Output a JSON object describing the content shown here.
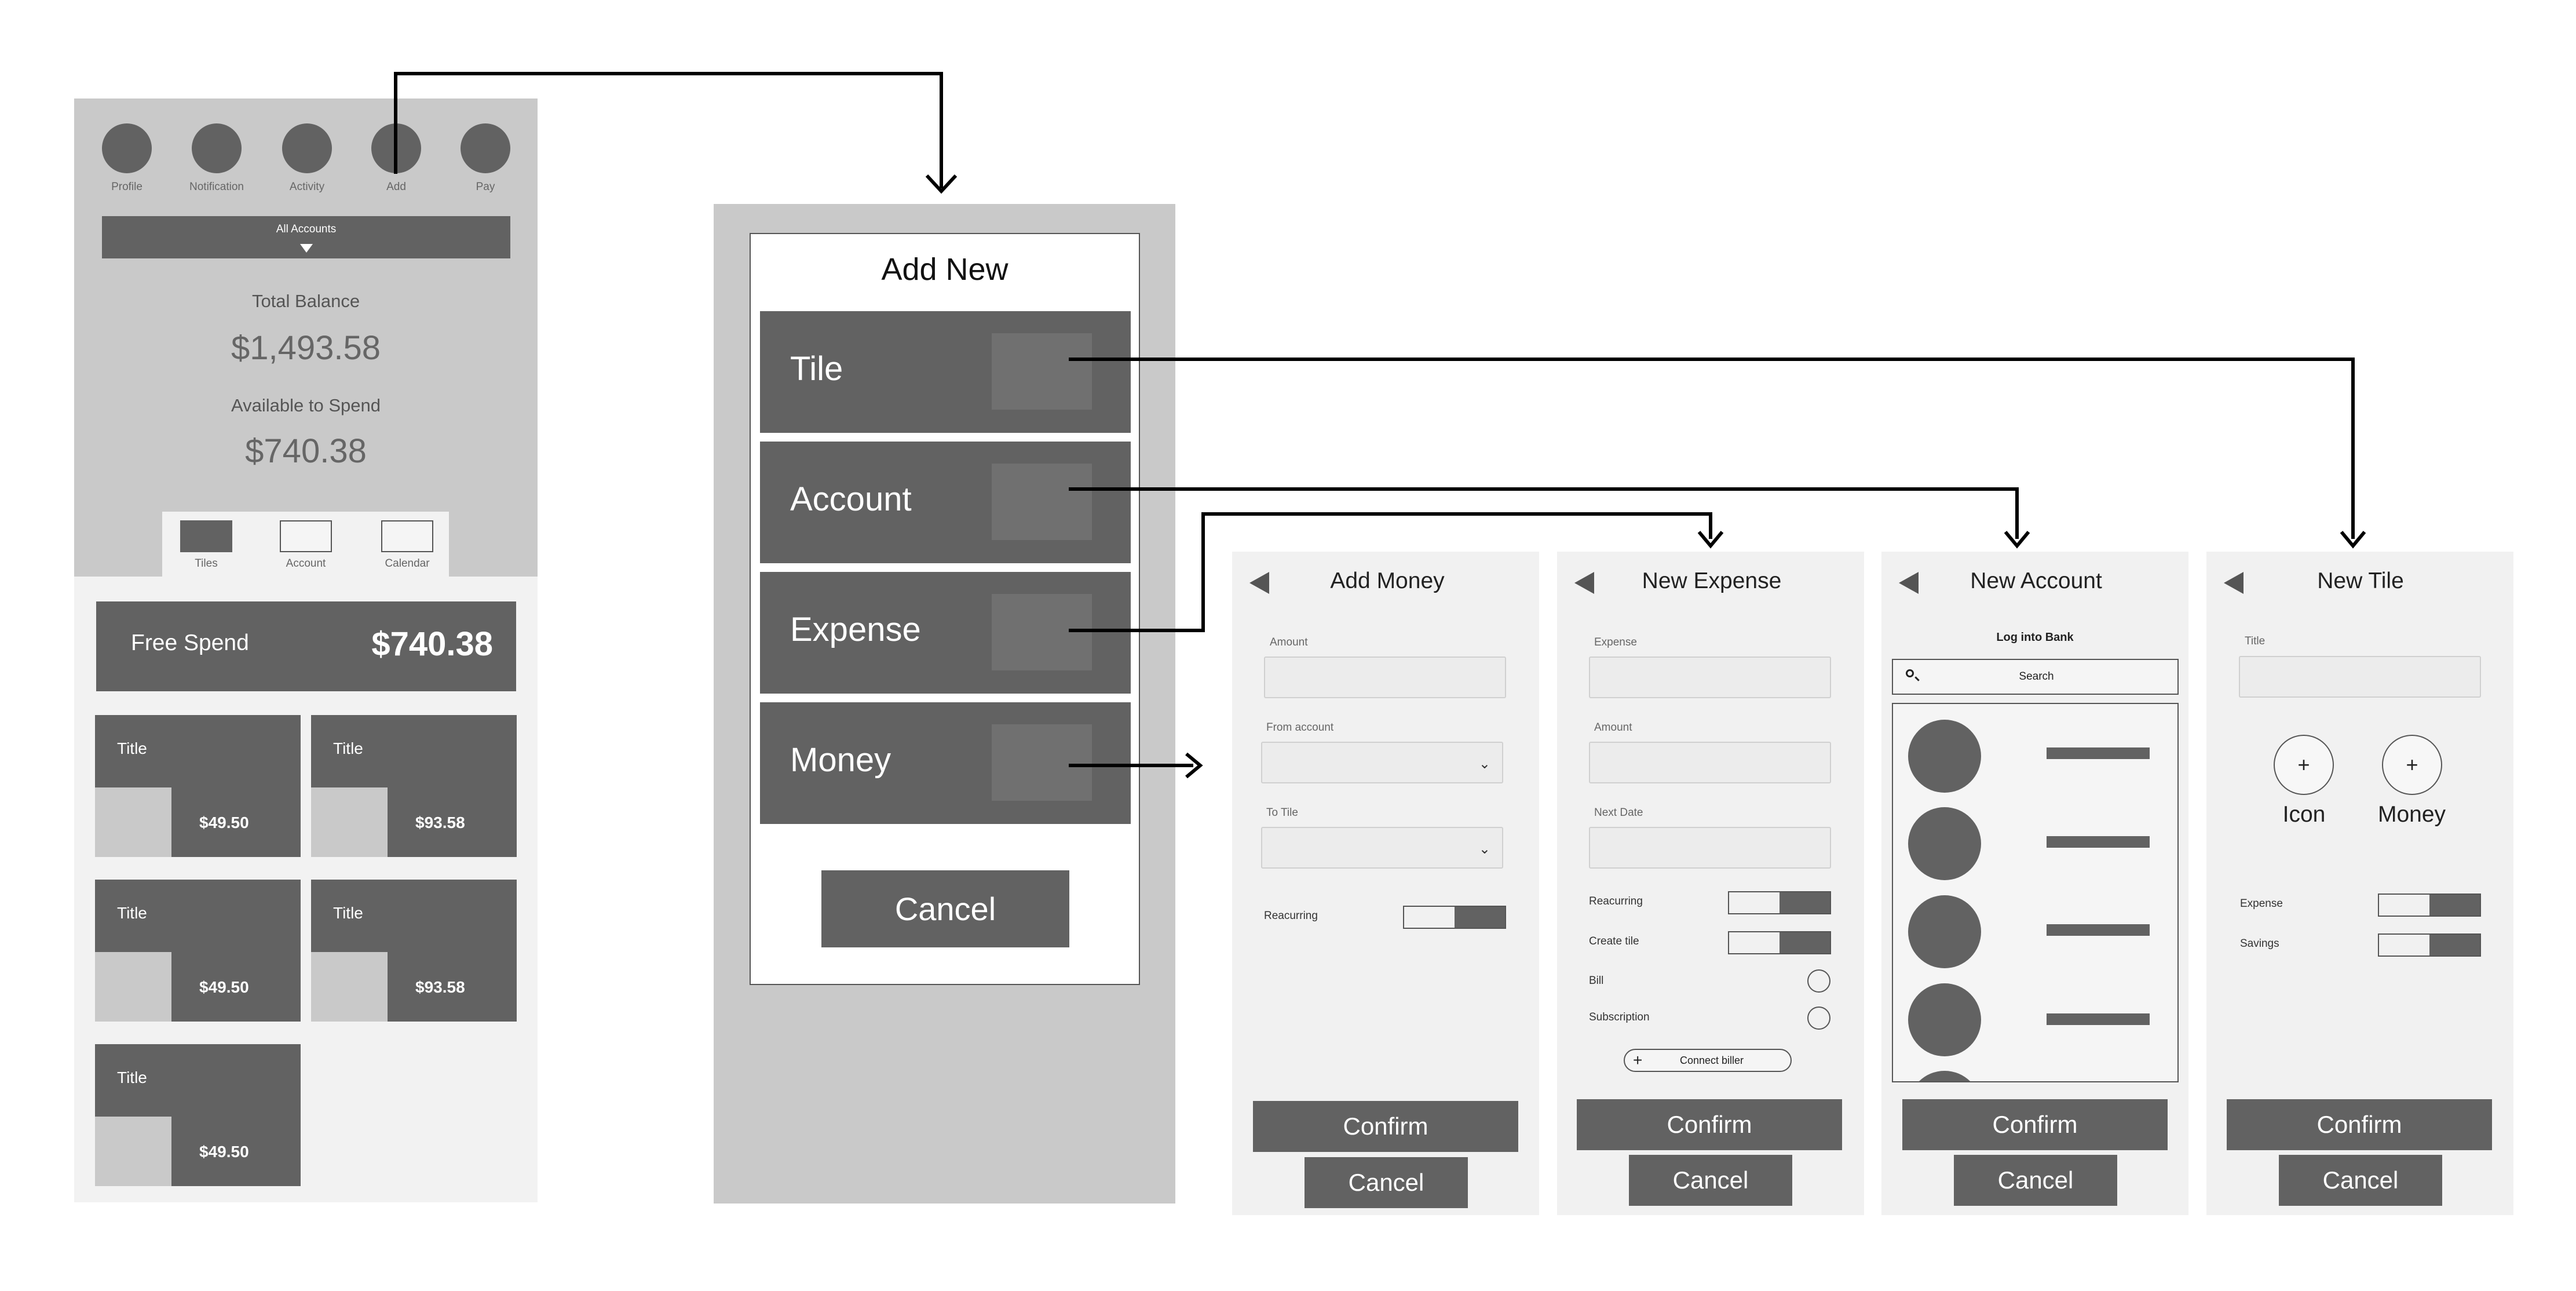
{
  "home": {
    "nav": [
      {
        "label": "Profile",
        "icon": "profile-icon"
      },
      {
        "label": "Notification",
        "icon": "notification-icon"
      },
      {
        "label": "Activity",
        "icon": "activity-icon"
      },
      {
        "label": "Add",
        "icon": "add-icon"
      },
      {
        "label": "Pay",
        "icon": "pay-icon"
      }
    ],
    "accounts_dropdown": "All Accounts",
    "total_balance_label": "Total Balance",
    "total_balance": "$1,493.58",
    "available_label": "Available to Spend",
    "available": "$740.38",
    "tabs": [
      {
        "label": "Tiles"
      },
      {
        "label": "Account"
      },
      {
        "label": "Calendar"
      }
    ],
    "free_spend_label": "Free Spend",
    "free_spend_value": "$740.38",
    "tiles": [
      {
        "title": "Title",
        "amount": "$49.50"
      },
      {
        "title": "Title",
        "amount": "$93.58"
      },
      {
        "title": "Title",
        "amount": "$49.50"
      },
      {
        "title": "Title",
        "amount": "$93.58"
      },
      {
        "title": "Title",
        "amount": "$49.50"
      }
    ]
  },
  "add_new": {
    "title": "Add New",
    "options": [
      {
        "label": "Tile"
      },
      {
        "label": "Account"
      },
      {
        "label": "Expense"
      },
      {
        "label": "Money"
      }
    ],
    "cancel": "Cancel"
  },
  "add_money": {
    "title": "Add Money",
    "amount_label": "Amount",
    "from_label": "From account",
    "to_label": "To Tile",
    "reacurring_label": "Reacurring",
    "confirm": "Confirm",
    "cancel": "Cancel"
  },
  "new_expense": {
    "title": "New Expense",
    "expense_label": "Expense",
    "amount_label": "Amount",
    "next_date_label": "Next Date",
    "reacurring_label": "Reacurring",
    "create_tile_label": "Create tile",
    "bill_label": "Bill",
    "subscription_label": "Subscription",
    "connect_biller": "Connect biller",
    "confirm": "Confirm",
    "cancel": "Cancel"
  },
  "new_account": {
    "title": "New Account",
    "subtitle": "Log into Bank",
    "search_placeholder": "Search",
    "confirm": "Confirm",
    "cancel": "Cancel"
  },
  "new_tile": {
    "title": "New Tile",
    "title_label": "Title",
    "icon_label": "Icon",
    "money_label": "Money",
    "expense_label": "Expense",
    "savings_label": "Savings",
    "confirm": "Confirm",
    "cancel": "Cancel"
  }
}
